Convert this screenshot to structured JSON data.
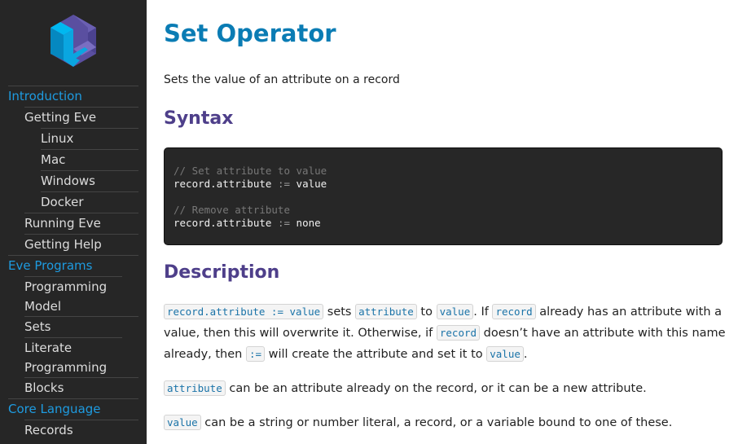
{
  "sidebar": {
    "logo": "eve-logo",
    "items": [
      {
        "label": "Introduction",
        "level": 0
      },
      {
        "label": "Getting Eve",
        "level": 1
      },
      {
        "label": "Linux",
        "level": 2
      },
      {
        "label": "Mac",
        "level": 2
      },
      {
        "label": "Windows",
        "level": 2
      },
      {
        "label": "Docker",
        "level": 2
      },
      {
        "label": "Running Eve",
        "level": 1
      },
      {
        "label": "Getting Help",
        "level": 1
      },
      {
        "label": "Eve Programs",
        "level": 0
      },
      {
        "label": "Programming Model",
        "level": 1
      },
      {
        "label": "Sets",
        "level": 1
      },
      {
        "label": "Literate Programming",
        "level": 1
      },
      {
        "label": "Blocks",
        "level": 1
      },
      {
        "label": "Core Language",
        "level": 0
      },
      {
        "label": "Records",
        "level": 1
      }
    ]
  },
  "main": {
    "title": "Set Operator",
    "subtitle": "Sets the value of an attribute on a record",
    "syntax_heading": "Syntax",
    "code": {
      "comment1": "// Set attribute to value",
      "line1_lhs": "record.attribute",
      "line1_op": ":=",
      "line1_rhs": "value",
      "comment2": "// Remove attribute",
      "line2_lhs": "record.attribute",
      "line2_op": ":=",
      "line2_rhs": "none"
    },
    "description_heading": "Description",
    "p1": {
      "c1": "record.attribute := value",
      "t1": " sets ",
      "c2": "attribute",
      "t2": " to ",
      "c3": "value",
      "t3": ". If ",
      "c4": "record",
      "t4": " already has an attribute with a value, then this will overwrite it. Otherwise, if ",
      "c5": "record",
      "t5": " doesn’t have an attribute with this name already, then ",
      "c6": ":=",
      "t6": " will create the attribute and set it to ",
      "c7": "value",
      "t7": "."
    },
    "p2": {
      "c1": "attribute",
      "t1": " can be an attribute already on the record, or it can be a new attribute."
    },
    "p3": {
      "c1": "value",
      "t1": " can be a string or number literal, a record, or a variable bound to one of these."
    }
  },
  "colors": {
    "sidebar_bg": "#262626",
    "section_link": "#1e9be0",
    "title": "#0a7cb4",
    "heading": "#4e3f8a",
    "code_bg": "#272727"
  }
}
